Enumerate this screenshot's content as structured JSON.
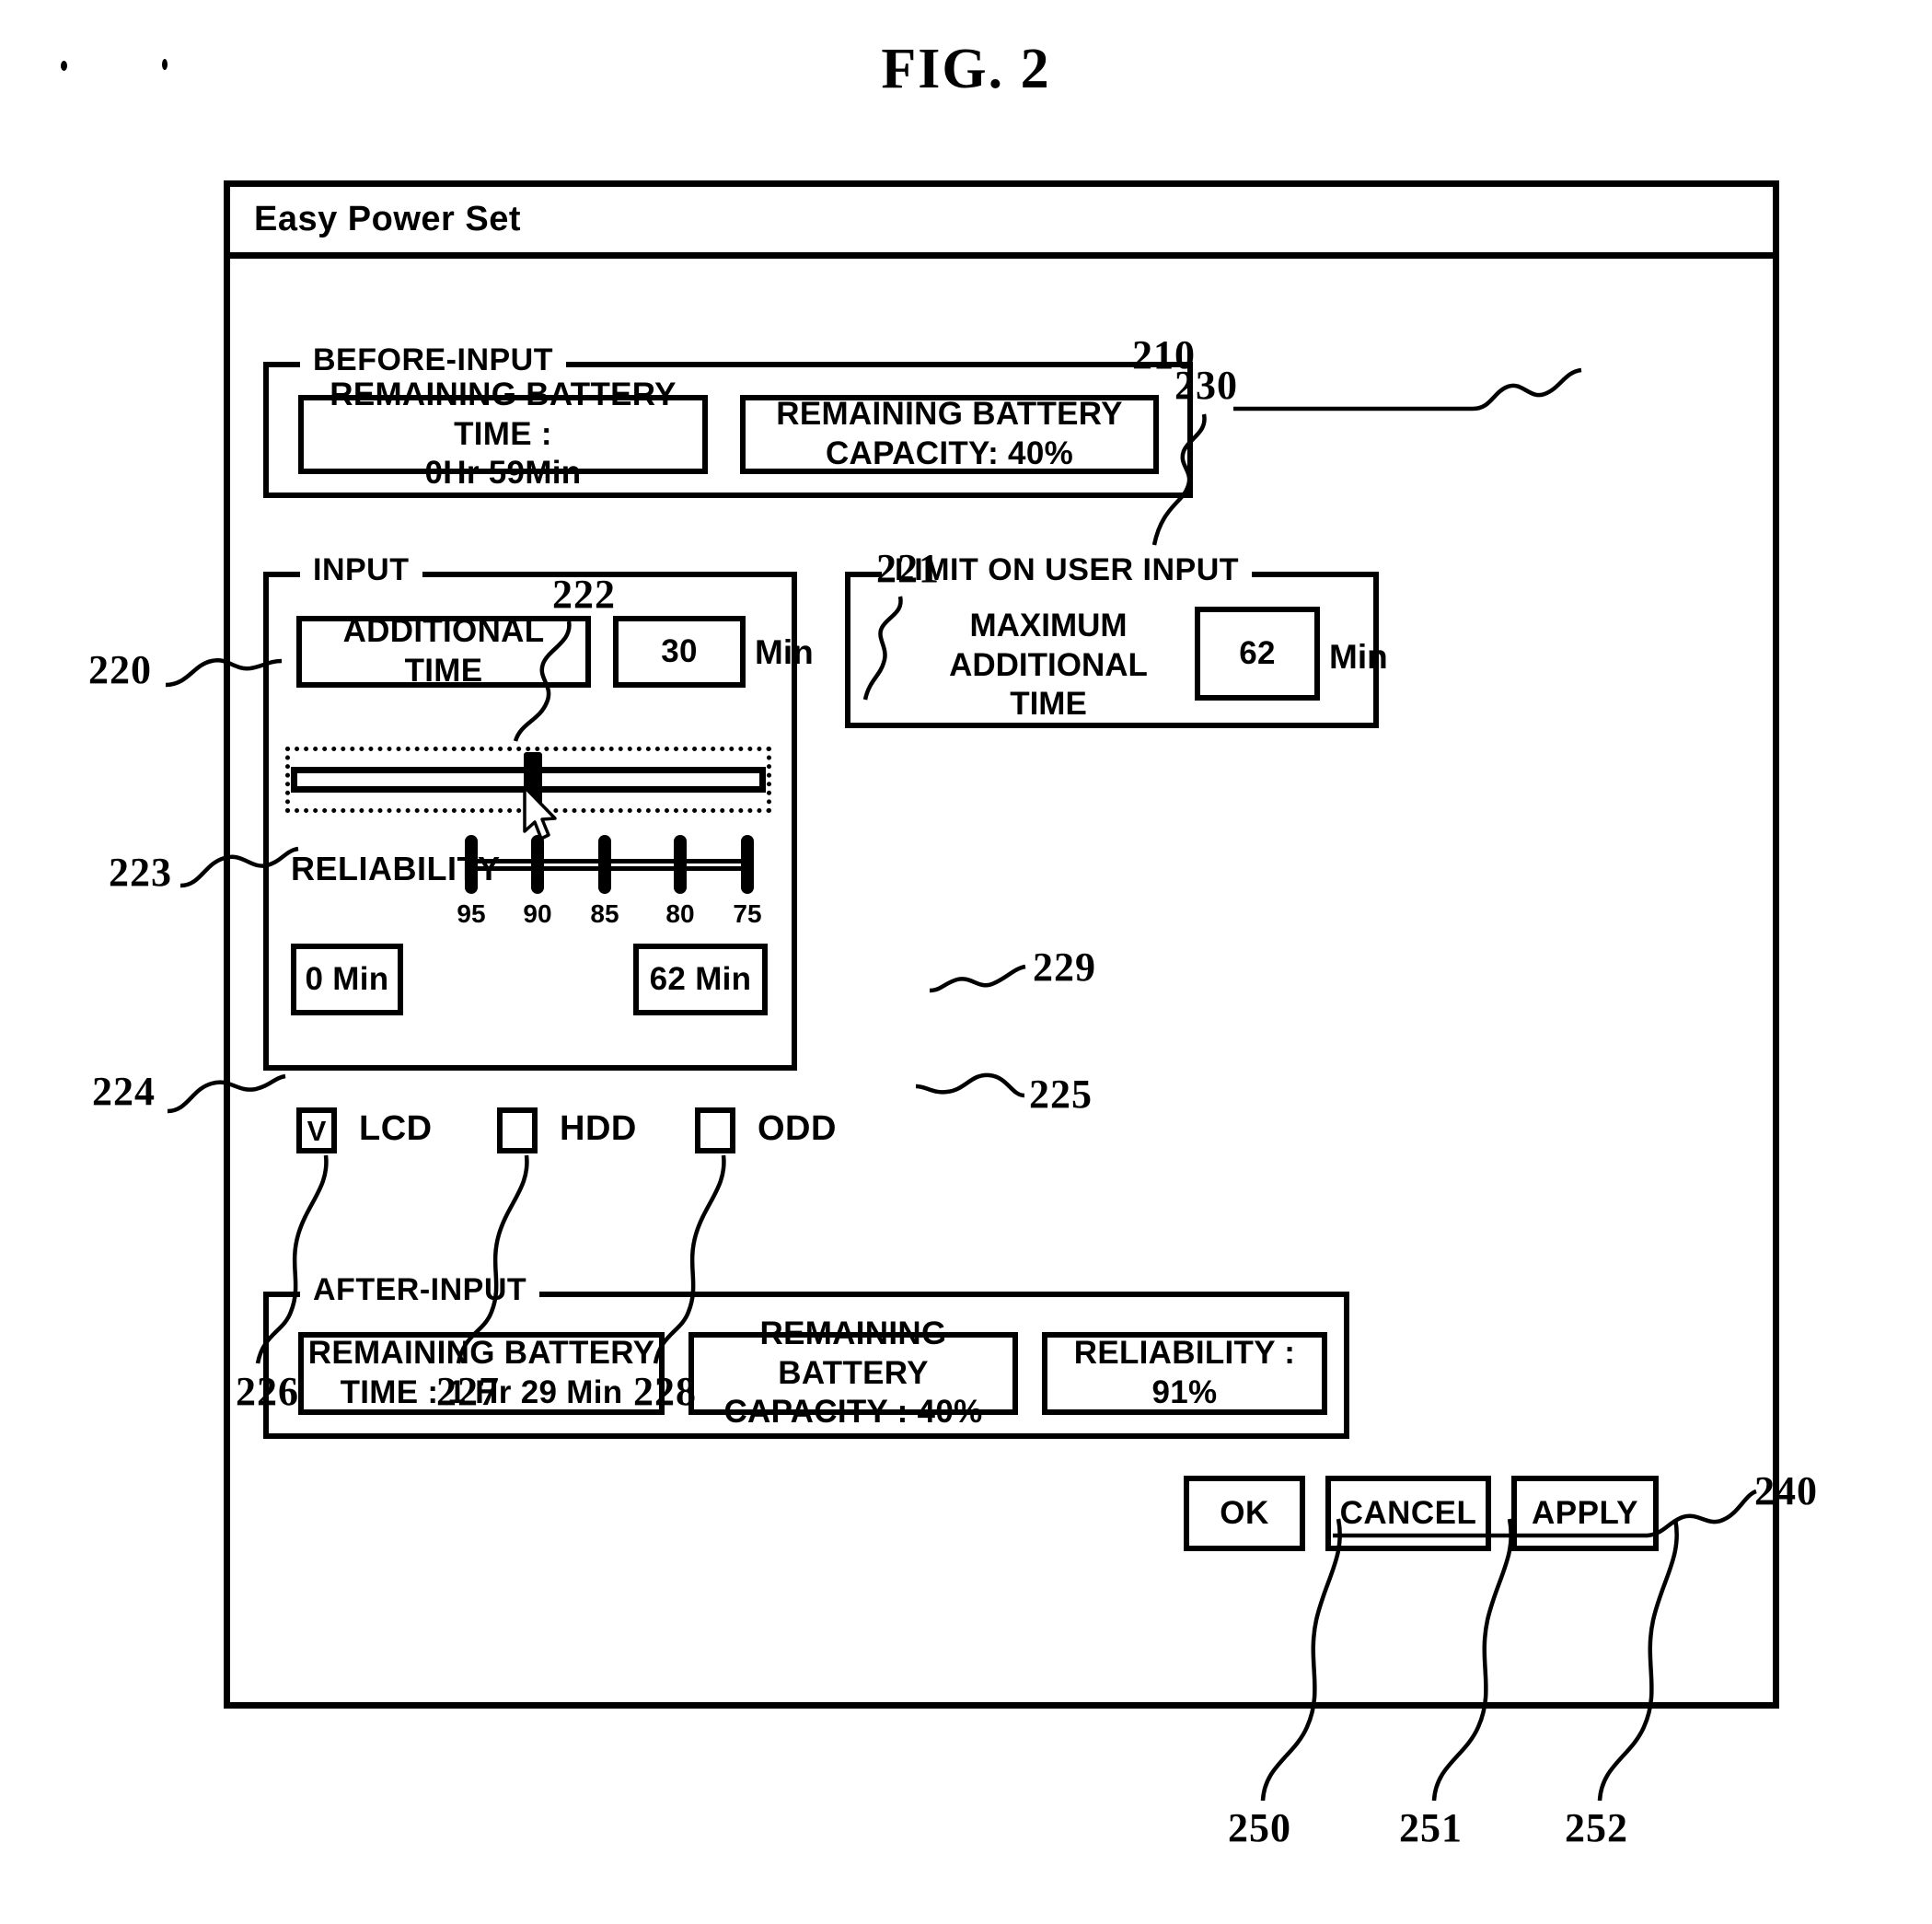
{
  "figure": {
    "title": "FIG. 2"
  },
  "window": {
    "title": "Easy Power Set"
  },
  "before_input": {
    "group_label": "BEFORE-INPUT",
    "ref": "210",
    "battery_time": {
      "line1": "REMAINING BATTERY TIME :",
      "line2": "0Hr 59Min"
    },
    "battery_capacity": {
      "line1": "REMAINING BATTERY",
      "line2": "CAPACITY: 40%"
    }
  },
  "input": {
    "group_label": "INPUT",
    "ref": "220",
    "additional_time_label": "ADDITIONAL TIME",
    "additional_time_value": "30",
    "additional_time_unit": "Min",
    "additional_time_ref": "221",
    "slider": {
      "thumb_ref": "222",
      "track_ref": "223",
      "value_percent": 48
    },
    "reliability": {
      "label": "RELIABILITY",
      "ref": "229",
      "ticks": [
        "95",
        "90",
        "85",
        "80",
        "75"
      ]
    },
    "min_value": "0 Min",
    "min_ref": "224",
    "max_value": "62 Min",
    "max_ref": "225"
  },
  "limit": {
    "group_label": "LIMIT ON USER INPUT",
    "ref": "230",
    "max_additional_time_line1": "MAXIMUM",
    "max_additional_time_line2": "ADDITIONAL TIME",
    "value": "62",
    "unit": "Min"
  },
  "devices": [
    {
      "label": "LCD",
      "checked": true,
      "mark": "V",
      "ref": "226"
    },
    {
      "label": "HDD",
      "checked": false,
      "mark": "",
      "ref": "227"
    },
    {
      "label": "ODD",
      "checked": false,
      "mark": "",
      "ref": "228"
    }
  ],
  "after_input": {
    "group_label": "AFTER-INPUT",
    "ref": "240",
    "battery_time": {
      "line1": "REMAINING BATTERY",
      "line2": "TIME : 1 Hr 29 Min"
    },
    "battery_capacity": {
      "line1": "REMAINING BATTERY",
      "line2": "CAPACITY : 40%"
    },
    "reliability": {
      "line1": "RELIABILITY : 91%"
    }
  },
  "buttons": [
    {
      "label": "OK",
      "ref": "250"
    },
    {
      "label": "CANCEL",
      "ref": "251"
    },
    {
      "label": "APPLY",
      "ref": "252"
    }
  ]
}
